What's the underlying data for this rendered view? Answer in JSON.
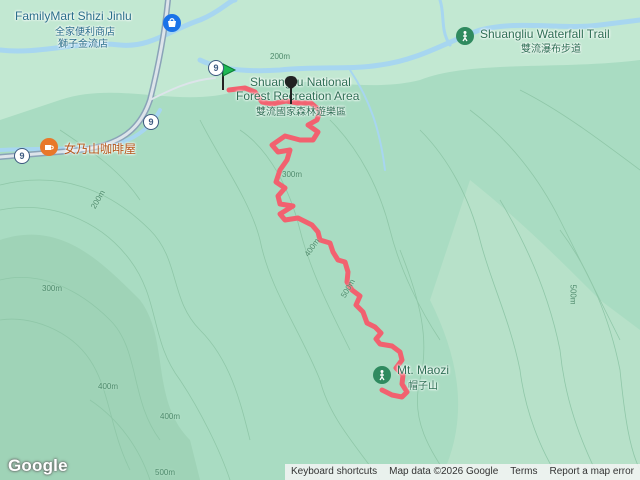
{
  "labels": {
    "familymart_en": "FamilyMart Shizi Jinlu",
    "familymart_zh1": "全家便利商店",
    "familymart_zh2": "獅子金流店",
    "cafe": "女乃山咖啡屋",
    "recreation_en1": "Shuangliu National",
    "recreation_en2": "Forest Recreation Area",
    "recreation_zh": "雙流國家森林遊樂區",
    "trail_en": "Shuangliu Waterfall Trail",
    "trail_zh": "雙流瀑布步道",
    "maozi_en": "Mt. Maozi",
    "maozi_zh": "帽子山"
  },
  "road_shields": [
    "9",
    "9",
    "9"
  ],
  "contours": [
    "200m",
    "200m",
    "300m",
    "300m",
    "400m",
    "400m",
    "400m",
    "500m",
    "500m",
    "500m"
  ],
  "attribution": {
    "logo": "Google",
    "keyboard": "Keyboard shortcuts",
    "map_data": "Map data ©2026 Google",
    "terms": "Terms",
    "report": "Report a map error"
  },
  "colors": {
    "terrain": "#a9dcc2",
    "river": "#a7d6f0",
    "road": "#8aa3b8",
    "track": "#f2616f",
    "start_pin": "#1db954",
    "end_pin": "#222222",
    "park_icon": "#2f8a5f",
    "cafe_icon": "#e8782a",
    "shop_icon": "#1a73e8"
  }
}
